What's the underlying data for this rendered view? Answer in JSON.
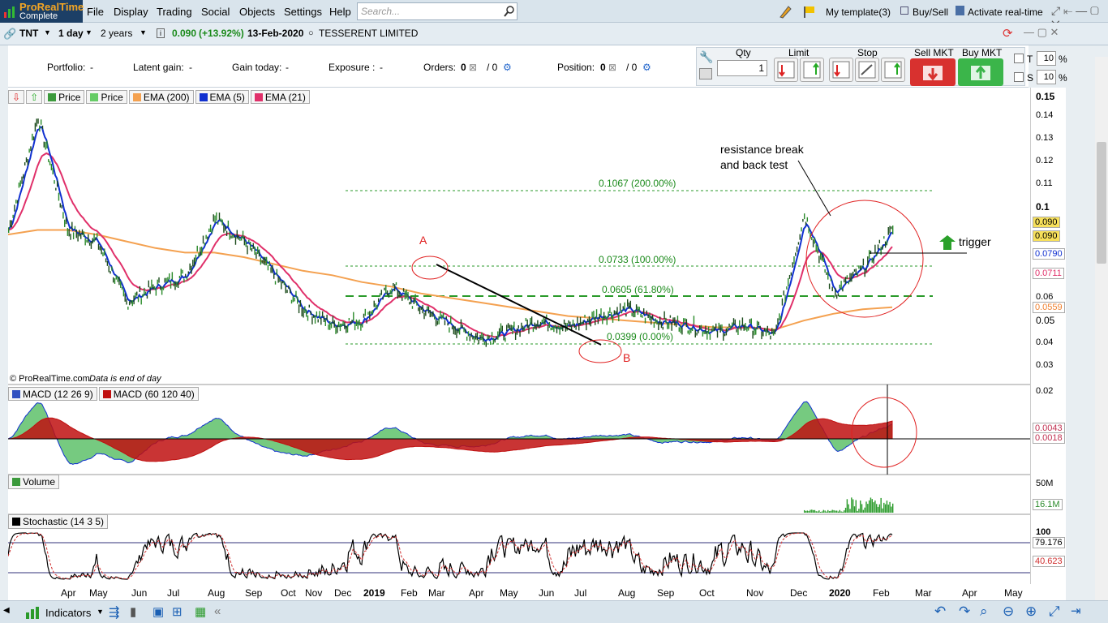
{
  "app": {
    "name": "ProRealTime",
    "edition": "Complete"
  },
  "menu": [
    "File",
    "Display",
    "Trading",
    "Social",
    "Objects",
    "Settings",
    "Help"
  ],
  "search": {
    "placeholder": "Search..."
  },
  "topright": {
    "template": "My template(3)",
    "buysell": "Buy/Sell",
    "activate": "Activate real-time"
  },
  "toolbar": {
    "ticker": "TNT",
    "interval": "1 day",
    "period": "2 years",
    "price": "0.090",
    "change": "(+13.92%)",
    "date": "13-Feb-2020",
    "company": "TESSERENT LIMITED"
  },
  "portfolio": {
    "portfolio_label": "Portfolio:",
    "portfolio_val": "-",
    "latent_label": "Latent gain:",
    "latent_val": "-",
    "today_label": "Gain today:",
    "today_val": "-",
    "exposure_label": "Exposure :",
    "exposure_val": "-",
    "orders_label": "Orders:",
    "orders_a": "0",
    "orders_b": "/ 0",
    "position_label": "Position:",
    "position_a": "0",
    "position_b": "/ 0"
  },
  "order": {
    "qty_label": "Qty",
    "qty_value": "1",
    "limit_label": "Limit",
    "stop_label": "Stop",
    "sell_label": "Sell MKT",
    "buy_label": "Buy MKT",
    "t_label": "T",
    "t_val": "10",
    "s_label": "S",
    "s_val": "10",
    "pct": "%"
  },
  "legend": {
    "items": [
      "Price",
      "Price",
      "EMA (200)",
      "EMA (5)",
      "EMA (21)"
    ],
    "colors": [
      "#3c9a3c",
      "#3c9a3c",
      "#f4a150",
      "#1030d0",
      "#e0306a"
    ]
  },
  "copyright": "© ProRealTime.com",
  "data_note": "Data is end of day",
  "annotations": {
    "fib_200": "0.1067 (200.00%)",
    "fib_100": "0.0733 (100.00%)",
    "fib_618": "0.0605 (61.80%)",
    "fib_0": "0.0399 (0.00%)",
    "point_a": "A",
    "point_b": "B",
    "resistance1": "resistance break",
    "resistance2": "and back test",
    "trigger": "trigger"
  },
  "price_axis": [
    "0.15",
    "0.14",
    "0.13",
    "0.12",
    "0.11",
    "0.1",
    "0.06",
    "0.05",
    "0.04",
    "0.03"
  ],
  "price_tags": {
    "p1": "0.090",
    "p2": "0.090",
    "ema5": "0.0790",
    "ema21": "0.0711",
    "ema200": "0.0559"
  },
  "macd": {
    "legend1": "MACD (12 26 9)",
    "legend2": "MACD (60 120 40)",
    "axis_top": "0.02",
    "tag1": "0.0043",
    "tag2": "0.0018"
  },
  "volume": {
    "legend": "Volume",
    "axis": "50M",
    "tag": "16.1M"
  },
  "stoch": {
    "legend": "Stochastic (14 3 5)",
    "axis": "100",
    "tag1": "79.176",
    "tag2": "40.623"
  },
  "time_axis": [
    "Apr",
    "May",
    "Jun",
    "Jul",
    "Aug",
    "Sep",
    "Oct",
    "Nov",
    "Dec",
    "2019",
    "Feb",
    "Mar",
    "Apr",
    "May",
    "Jun",
    "Jul",
    "Aug",
    "Sep",
    "Oct",
    "Nov",
    "Dec",
    "2020",
    "Feb",
    "Mar",
    "Apr",
    "May"
  ],
  "bottom": {
    "indicators": "Indicators"
  },
  "chart_data": {
    "type": "line",
    "title": "TNT",
    "ylim": [
      0.025,
      0.155
    ],
    "fib_levels": [
      0.1067,
      0.0733,
      0.0605,
      0.0399
    ],
    "x": [
      0,
      20,
      40,
      60,
      80,
      100,
      120,
      140,
      160,
      180,
      200,
      220,
      240,
      260,
      280,
      300,
      320,
      340,
      360,
      380,
      400,
      420,
      440,
      460,
      480,
      500,
      520,
      540,
      560,
      580,
      600
    ],
    "series": [
      {
        "name": "Price",
        "values": [
          0.09,
          0.14,
          0.09,
          0.085,
          0.058,
          0.065,
          0.07,
          0.095,
          0.085,
          0.07,
          0.055,
          0.048,
          0.05,
          0.065,
          0.055,
          0.048,
          0.042,
          0.045,
          0.05,
          0.047,
          0.052,
          0.055,
          0.05,
          0.048,
          0.045,
          0.048,
          0.043,
          0.097,
          0.062,
          0.073,
          0.09
        ]
      },
      {
        "name": "EMA (200)",
        "values": [
          0.088,
          0.09,
          0.09,
          0.088,
          0.085,
          0.082,
          0.08,
          0.08,
          0.078,
          0.075,
          0.072,
          0.07,
          0.067,
          0.065,
          0.062,
          0.06,
          0.058,
          0.056,
          0.054,
          0.052,
          0.051,
          0.05,
          0.049,
          0.048,
          0.047,
          0.047,
          0.046,
          0.05,
          0.053,
          0.055,
          0.0559
        ]
      }
    ]
  }
}
